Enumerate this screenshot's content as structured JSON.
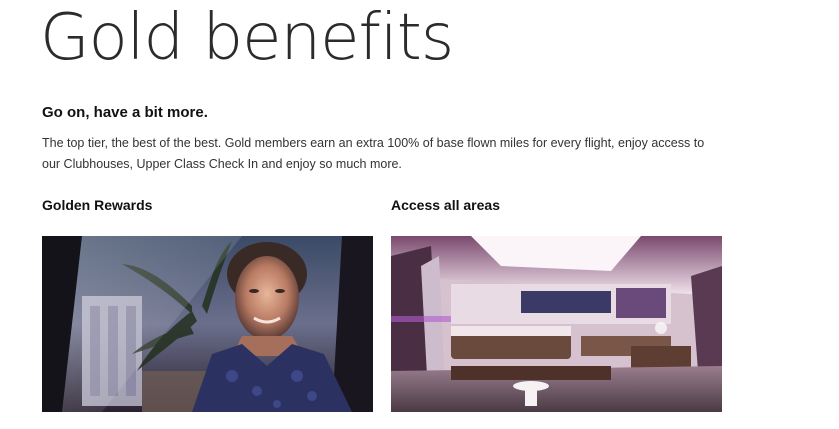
{
  "page": {
    "title": "Gold benefits",
    "subtitle": "Go on, have a bit more.",
    "intro_line1": "The top tier, the best of the best. Gold members earn an extra 100% of base flown miles for every flight, enjoy access to",
    "intro_line2": "our Clubhouses, Upper Class Check In and enjoy so much more."
  },
  "columns": [
    {
      "heading": "Golden Rewards",
      "image": "man-in-car-window-photo"
    },
    {
      "heading": "Access all areas",
      "image": "clubhouse-lounge-photo"
    }
  ]
}
